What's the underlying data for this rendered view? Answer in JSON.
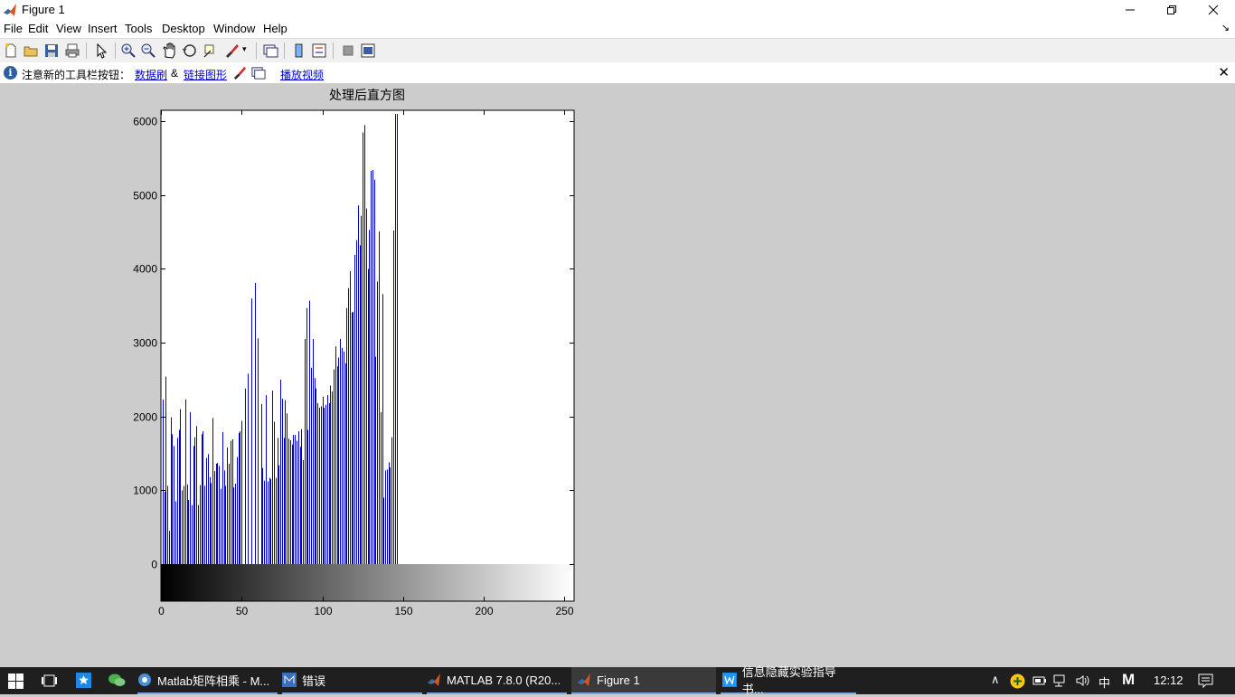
{
  "window": {
    "title": "Figure 1"
  },
  "menu": [
    "File",
    "Edit",
    "View",
    "Insert",
    "Tools",
    "Desktop",
    "Window",
    "Help"
  ],
  "infobar": {
    "notice": "注意新的工具栏按钮：",
    "link_data_brush": "数据刷",
    "amp": "&",
    "link_linked_plot": "链接图形",
    "link_play_video": "播放视频"
  },
  "chart_data": {
    "type": "bar",
    "title": "处理后直方图",
    "xlabel": "",
    "ylabel": "",
    "xlim": [
      0,
      256
    ],
    "ylim": [
      0,
      6150
    ],
    "xticks": [
      0,
      50,
      100,
      150,
      200,
      250
    ],
    "yticks": [
      0,
      1000,
      2000,
      3000,
      4000,
      5000,
      6000
    ],
    "bar_color": "#0000cc",
    "colorbar": "grayscale 0-255 below plot",
    "bars": [
      [
        1,
        2230
      ],
      [
        2,
        980
      ],
      [
        3,
        2540
      ],
      [
        4,
        1060
      ],
      [
        5,
        450
      ],
      [
        6,
        1990
      ],
      [
        7,
        1760
      ],
      [
        8,
        1600
      ],
      [
        9,
        850
      ],
      [
        10,
        1710
      ],
      [
        11,
        1820
      ],
      [
        12,
        2100
      ],
      [
        13,
        1000
      ],
      [
        14,
        1060
      ],
      [
        15,
        2230
      ],
      [
        16,
        1080
      ],
      [
        17,
        870
      ],
      [
        18,
        2060
      ],
      [
        19,
        800
      ],
      [
        20,
        1600
      ],
      [
        21,
        1720
      ],
      [
        22,
        1870
      ],
      [
        23,
        800
      ],
      [
        24,
        1070
      ],
      [
        25,
        1760
      ],
      [
        26,
        1800
      ],
      [
        27,
        1060
      ],
      [
        28,
        1440
      ],
      [
        29,
        1490
      ],
      [
        30,
        1180
      ],
      [
        31,
        1100
      ],
      [
        32,
        1980
      ],
      [
        33,
        1260
      ],
      [
        34,
        1360
      ],
      [
        35,
        1370
      ],
      [
        36,
        1330
      ],
      [
        37,
        1020
      ],
      [
        38,
        1790
      ],
      [
        39,
        1270
      ],
      [
        40,
        1060
      ],
      [
        41,
        1580
      ],
      [
        42,
        1360
      ],
      [
        43,
        1670
      ],
      [
        44,
        1690
      ],
      [
        45,
        1040
      ],
      [
        46,
        1090
      ],
      [
        47,
        1450
      ],
      [
        48,
        1780
      ],
      [
        49,
        1800
      ],
      [
        50,
        1940
      ],
      [
        52,
        2380
      ],
      [
        54,
        2580
      ],
      [
        56,
        3600
      ],
      [
        58,
        3810
      ],
      [
        60,
        3060
      ],
      [
        62,
        2170
      ],
      [
        63,
        1300
      ],
      [
        64,
        1130
      ],
      [
        65,
        2290
      ],
      [
        66,
        1120
      ],
      [
        67,
        1170
      ],
      [
        68,
        1150
      ],
      [
        69,
        2350
      ],
      [
        70,
        1930
      ],
      [
        71,
        1170
      ],
      [
        72,
        1710
      ],
      [
        73,
        1340
      ],
      [
        74,
        2500
      ],
      [
        75,
        2240
      ],
      [
        76,
        1710
      ],
      [
        77,
        2220
      ],
      [
        78,
        2040
      ],
      [
        79,
        1700
      ],
      [
        80,
        1680
      ],
      [
        81,
        1620
      ],
      [
        82,
        1750
      ],
      [
        83,
        1750
      ],
      [
        84,
        1670
      ],
      [
        85,
        1800
      ],
      [
        86,
        1590
      ],
      [
        87,
        1830
      ],
      [
        88,
        1410
      ],
      [
        89,
        3050
      ],
      [
        90,
        3470
      ],
      [
        91,
        1820
      ],
      [
        92,
        3570
      ],
      [
        93,
        2660
      ],
      [
        94,
        3050
      ],
      [
        95,
        2520
      ],
      [
        96,
        2380
      ],
      [
        97,
        2180
      ],
      [
        98,
        2120
      ],
      [
        99,
        2140
      ],
      [
        100,
        2270
      ],
      [
        101,
        2120
      ],
      [
        102,
        2160
      ],
      [
        103,
        2290
      ],
      [
        104,
        2180
      ],
      [
        105,
        2420
      ],
      [
        106,
        2340
      ],
      [
        107,
        2640
      ],
      [
        108,
        2950
      ],
      [
        109,
        2680
      ],
      [
        110,
        2800
      ],
      [
        111,
        3050
      ],
      [
        112,
        2930
      ],
      [
        113,
        2880
      ],
      [
        114,
        2720
      ],
      [
        115,
        3470
      ],
      [
        116,
        3740
      ],
      [
        117,
        3970
      ],
      [
        118,
        3410
      ],
      [
        119,
        3420
      ],
      [
        120,
        4190
      ],
      [
        121,
        4390
      ],
      [
        122,
        4860
      ],
      [
        123,
        4320
      ],
      [
        124,
        4720
      ],
      [
        125,
        5850
      ],
      [
        126,
        5950
      ],
      [
        127,
        4820
      ],
      [
        128,
        4000
      ],
      [
        129,
        4530
      ],
      [
        130,
        5330
      ],
      [
        131,
        5340
      ],
      [
        132,
        5210
      ],
      [
        133,
        2810
      ],
      [
        134,
        3830
      ],
      [
        135,
        4510
      ],
      [
        136,
        2060
      ],
      [
        137,
        3660
      ],
      [
        138,
        900
      ],
      [
        139,
        1270
      ],
      [
        140,
        1280
      ],
      [
        141,
        1380
      ],
      [
        142,
        1310
      ],
      [
        143,
        1720
      ],
      [
        144,
        4520
      ],
      [
        145,
        6100
      ],
      [
        146,
        6100
      ]
    ]
  },
  "taskbar": {
    "items": [
      "Matlab矩阵相乘 - M...",
      "错误",
      "MATLAB  7.8.0 (R20...",
      "Figure 1",
      "信息隐藏实验指导书..."
    ],
    "ime": "中",
    "ime2": "M",
    "time": "12:12"
  }
}
